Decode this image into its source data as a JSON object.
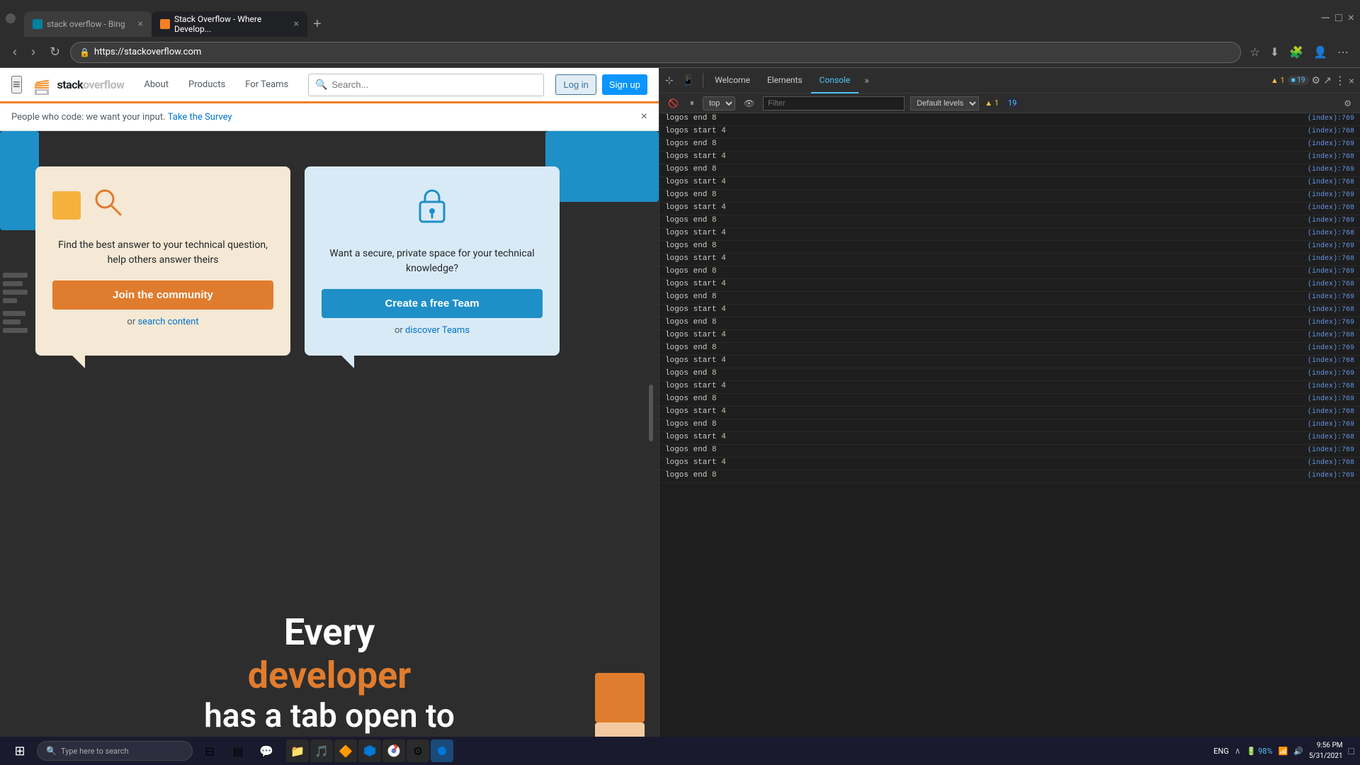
{
  "browser": {
    "tabs": [
      {
        "id": "tab1",
        "label": "stack overflow - Bing",
        "favicon_type": "bing",
        "active": false
      },
      {
        "id": "tab2",
        "label": "Stack Overflow - Where Develop...",
        "favicon_type": "so",
        "active": true
      }
    ],
    "address": "https://stackoverflow.com",
    "new_tab_label": "+",
    "nav_back": "‹",
    "nav_forward": "›",
    "nav_refresh": "↻"
  },
  "so_site": {
    "header": {
      "hamburger": "≡",
      "logo_text1": "stack",
      "logo_text2": "overflow",
      "nav_items": [
        "About",
        "Products",
        "For Teams"
      ],
      "search_placeholder": "Search...",
      "search_icon": "🔍",
      "login_label": "Log in",
      "signup_label": "Sign up"
    },
    "survey_banner": {
      "text": "People who code: we want your input.",
      "link_text": "Take the Survey",
      "close": "×"
    },
    "card_community": {
      "title": "Find the best answer to your technical question, help others answer theirs",
      "btn_label": "Join the community",
      "link_prefix": "or",
      "link_text": "search content"
    },
    "card_teams": {
      "title": "Want a secure, private space for your technical knowledge?",
      "btn_label": "Create a free Team",
      "link_prefix": "or",
      "link_text": "discover Teams"
    },
    "hero": {
      "line1": "Every",
      "line2": "developer",
      "line3": "has a tab open to"
    }
  },
  "devtools": {
    "tabs": [
      "Welcome",
      "Elements",
      "Console",
      "»"
    ],
    "active_tab": "Console",
    "toolbar": {
      "dropdown_top": "top",
      "filter_placeholder": "Filter",
      "dropdown_levels": "Default levels",
      "warning_count": "▲ 1",
      "info_count": "⬛ 19",
      "badge_19": "19"
    },
    "console_lines": [
      {
        "text": "logos end",
        "val": "8",
        "link": "(index):769"
      },
      {
        "text": "logos start",
        "val": "4",
        "link": "(index):768"
      },
      {
        "text": "logos end",
        "val": "8",
        "link": "(index):769"
      },
      {
        "text": "logos start",
        "val": "4",
        "link": "(index):768"
      },
      {
        "text": "logos end",
        "val": "8",
        "link": "(index):769"
      },
      {
        "text": "logos start",
        "val": "4",
        "link": "(index):768"
      },
      {
        "text": "logos end",
        "val": "8",
        "link": "(index):769"
      },
      {
        "text": "logos start",
        "val": "4",
        "link": "(index):768"
      },
      {
        "text": "logos end",
        "val": "8",
        "link": "(index):769"
      },
      {
        "text": "logos start",
        "val": "4",
        "link": "(index):768"
      },
      {
        "text": "logos end",
        "val": "8",
        "link": "(index):769"
      },
      {
        "text": "logos start",
        "val": "4",
        "link": "(index):768"
      },
      {
        "text": "logos end",
        "val": "8",
        "link": "(index):769"
      },
      {
        "text": "logos start",
        "val": "4",
        "link": "(index):768"
      },
      {
        "text": "logos end",
        "val": "8",
        "link": "(index):769"
      },
      {
        "text": "logos start",
        "val": "4",
        "link": "(index):768"
      },
      {
        "text": "logos end",
        "val": "8",
        "link": "(index):769"
      },
      {
        "text": "logos start",
        "val": "4",
        "link": "(index):768"
      },
      {
        "text": "logos end",
        "val": "8",
        "link": "(index):769"
      },
      {
        "text": "logos start",
        "val": "4",
        "link": "(index):768"
      },
      {
        "text": "logos end",
        "val": "8",
        "link": "(index):769"
      },
      {
        "text": "logos start",
        "val": "4",
        "link": "(index):768"
      },
      {
        "text": "logos end",
        "val": "8",
        "link": "(index):769"
      },
      {
        "text": "logos start",
        "val": "4",
        "link": "(index):768"
      },
      {
        "text": "logos end",
        "val": "8",
        "link": "(index):769"
      },
      {
        "text": "logos start",
        "val": "4",
        "link": "(index):768"
      },
      {
        "text": "logos end",
        "val": "8",
        "link": "(index):769"
      },
      {
        "text": "logos start",
        "val": "4",
        "link": "(index):768"
      },
      {
        "text": "logos end",
        "val": "8",
        "link": "(index):769"
      }
    ],
    "bottom": {
      "prompt_icon": ">",
      "close_label": "×"
    }
  },
  "taskbar": {
    "start_icon": "⊞",
    "search_text": "Type here to search",
    "clock": "9:56 PM\n5/31/2021",
    "battery": "98%",
    "apps": [
      "📁",
      "🎬",
      "🔊",
      "💻",
      "🌐",
      "⚙"
    ],
    "devtools_icons": [
      "⚙",
      "🔄"
    ]
  }
}
